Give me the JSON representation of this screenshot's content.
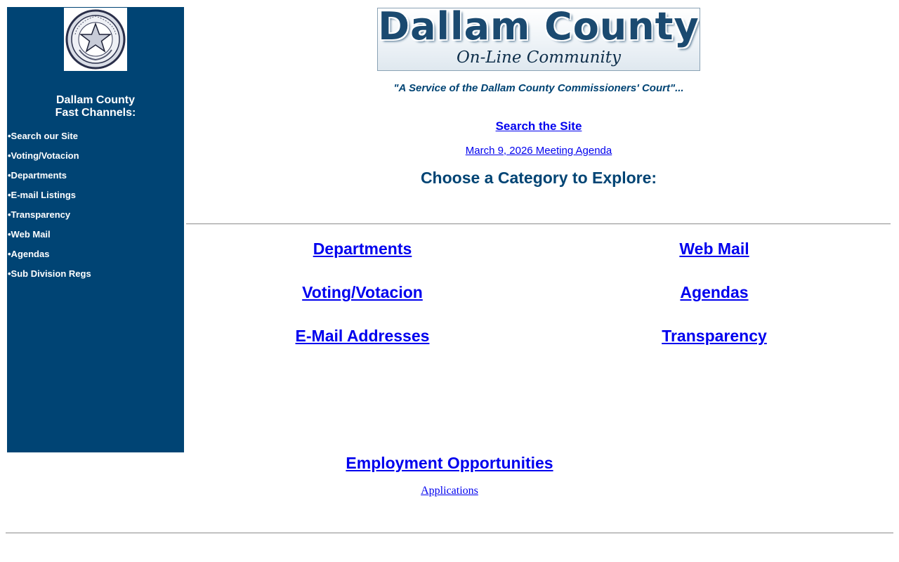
{
  "sidebar": {
    "seal_icon": "texas-state-seal-icon",
    "heading_line1": "Dallam County",
    "heading_line2": "Fast Channels:",
    "items": [
      {
        "label": "•Search our Site"
      },
      {
        "label": "•Voting/Votacion"
      },
      {
        "label": "•Departments"
      },
      {
        "label": "•E-mail Listings"
      },
      {
        "label": "•Transparency"
      },
      {
        "label": "•Web Mail"
      },
      {
        "label": "•Agendas"
      },
      {
        "label": "•Sub Division Regs"
      }
    ],
    "bg_color": "#004474"
  },
  "header": {
    "banner_title": "Dallam County",
    "banner_subtitle": "On-Line Community",
    "tagline": "\"A Service of the Dallam County Commissioners' Court\"...",
    "search_link": "Search the Site",
    "agenda_link": "March 9, 2026 Meeting Agenda",
    "explore_heading": "Choose a Category to Explore:"
  },
  "categories": {
    "departments": "Departments",
    "web_mail": "Web Mail",
    "voting": "Voting/Votacion",
    "agendas": "Agendas",
    "email_addresses": "E-Mail Addresses",
    "transparency": "Transparency"
  },
  "footer": {
    "employment": "Employment Opportunities",
    "applications": "Applications"
  },
  "colors": {
    "accent": "#004474",
    "link": "#0000ee"
  }
}
